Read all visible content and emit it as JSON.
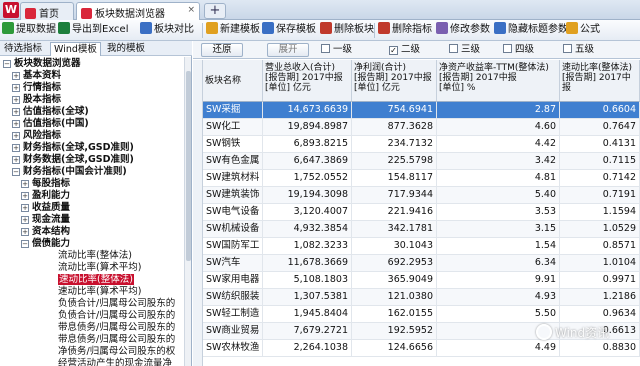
{
  "titlebar": {
    "home_tab": "首页",
    "active_tab": "板块数据浏览器",
    "close_glyph": "×",
    "add_glyph": "+",
    "logo_letter": "W"
  },
  "toolbar": {
    "buttons": [
      {
        "label": "提取数据",
        "icon": "extract-icon",
        "color": "#2e9a3a"
      },
      {
        "label": "导出到Excel",
        "icon": "excel-icon",
        "color": "#1e7f3c"
      },
      {
        "label": "板块对比",
        "icon": "compare-icon",
        "color": "#3a6fc4"
      },
      {
        "label": "新建模板",
        "icon": "new-template-icon",
        "color": "#e0a020"
      },
      {
        "label": "保存模板",
        "icon": "save-template-icon",
        "color": "#3a6fc4"
      },
      {
        "label": "删除板块",
        "icon": "delete-sector-icon",
        "color": "#c0392b"
      },
      {
        "label": "删除指标",
        "icon": "delete-indicator-icon",
        "color": "#c0392b"
      },
      {
        "label": "修改参数",
        "icon": "edit-params-icon",
        "color": "#7a5fb0"
      },
      {
        "label": "隐藏标题参数",
        "icon": "hide-title-icon",
        "color": "#3a6fc4"
      },
      {
        "label": "公式",
        "icon": "formula-icon",
        "color": "#e0a020"
      }
    ]
  },
  "left": {
    "tabs": [
      "待选指标",
      "Wind模板",
      "我的模板"
    ],
    "tree": [
      {
        "label": "板块数据浏览器",
        "level": 0,
        "expander": "−",
        "bold": true
      },
      {
        "label": "基本资料",
        "level": 1,
        "expander": "+",
        "bold": true
      },
      {
        "label": "行情指标",
        "level": 1,
        "expander": "+",
        "bold": true
      },
      {
        "label": "股本指标",
        "level": 1,
        "expander": "+",
        "bold": true
      },
      {
        "label": "估值指标(全球)",
        "level": 1,
        "expander": "+",
        "bold": true
      },
      {
        "label": "估值指标(中国)",
        "level": 1,
        "expander": "+",
        "bold": true
      },
      {
        "label": "风险指标",
        "level": 1,
        "expander": "+",
        "bold": true
      },
      {
        "label": "财务指标(全球,GSD准则)",
        "level": 1,
        "expander": "+",
        "bold": true
      },
      {
        "label": "财务数据(全球,GSD准则)",
        "level": 1,
        "expander": "+",
        "bold": true
      },
      {
        "label": "财务指标(中国会计准则)",
        "level": 1,
        "expander": "−",
        "bold": true
      },
      {
        "label": "每股指标",
        "level": 2,
        "expander": "+",
        "bold": true
      },
      {
        "label": "盈利能力",
        "level": 2,
        "expander": "+",
        "bold": true
      },
      {
        "label": "收益质量",
        "level": 2,
        "expander": "+",
        "bold": true
      },
      {
        "label": "现金流量",
        "level": 2,
        "expander": "+",
        "bold": true
      },
      {
        "label": "资本结构",
        "level": 2,
        "expander": "+",
        "bold": true
      },
      {
        "label": "偿债能力",
        "level": 2,
        "expander": "−",
        "bold": true
      },
      {
        "label": "流动比率(整体法)",
        "level": 3,
        "expander": "",
        "bold": false
      },
      {
        "label": "流动比率(算术平均)",
        "level": 3,
        "expander": "",
        "bold": false
      },
      {
        "label": "速动比率(整体法)",
        "level": 3,
        "expander": "",
        "bold": false,
        "selected": true
      },
      {
        "label": "速动比率(算术平均)",
        "level": 3,
        "expander": "",
        "bold": false
      },
      {
        "label": "负债合计/归属母公司股东的",
        "level": 3,
        "expander": "",
        "bold": false
      },
      {
        "label": "负债合计/归属母公司股东的",
        "level": 3,
        "expander": "",
        "bold": false
      },
      {
        "label": "带息债务/归属母公司股东的",
        "level": 3,
        "expander": "",
        "bold": false
      },
      {
        "label": "带息债务/归属母公司股东的",
        "level": 3,
        "expander": "",
        "bold": false
      },
      {
        "label": "净债务/归属母公司股东的权",
        "level": 3,
        "expander": "",
        "bold": false
      },
      {
        "label": "经营活动产生的现金流量净",
        "level": 3,
        "expander": "",
        "bold": false
      }
    ]
  },
  "filter": {
    "restore": "还原",
    "expand": "展开",
    "levels": [
      {
        "label": "一级",
        "checked": false
      },
      {
        "label": "二级",
        "checked": true
      },
      {
        "label": "三级",
        "checked": false
      },
      {
        "label": "四级",
        "checked": false
      },
      {
        "label": "五级",
        "checked": false
      }
    ],
    "check_glyph": "✓"
  },
  "table": {
    "headers": [
      "板块名称",
      "营业总收入(合计)\n[报告期] 2017中报\n[单位] 亿元",
      "净利润(合计)\n[报告期] 2017中报\n[单位] 亿元",
      "净资产收益率-TTM(整体法)\n[报告期] 2017中报\n[单位] %",
      "速动比率(整体法)\n[报告期] 2017中报"
    ],
    "rows": [
      [
        "SW采掘",
        "14,673.6639",
        "754.6941",
        "2.87",
        "0.6604"
      ],
      [
        "SW化工",
        "19,894.8987",
        "877.3628",
        "4.60",
        "0.7647"
      ],
      [
        "SW钢铁",
        "6,893.8215",
        "234.7132",
        "4.42",
        "0.4131"
      ],
      [
        "SW有色金属",
        "6,647.3869",
        "225.5798",
        "3.42",
        "0.7115"
      ],
      [
        "SW建筑材料",
        "1,752.0552",
        "154.8117",
        "4.81",
        "0.7142"
      ],
      [
        "SW建筑装饰",
        "19,194.3098",
        "717.9344",
        "5.40",
        "0.7191"
      ],
      [
        "SW电气设备",
        "3,120.4007",
        "221.9416",
        "3.53",
        "1.1594"
      ],
      [
        "SW机械设备",
        "4,932.3854",
        "342.1781",
        "3.15",
        "1.0529"
      ],
      [
        "SW国防军工",
        "1,082.3233",
        "30.1043",
        "1.54",
        "0.8571"
      ],
      [
        "SW汽车",
        "11,678.3669",
        "692.2953",
        "6.34",
        "1.0104"
      ],
      [
        "SW家用电器",
        "5,108.1803",
        "365.9049",
        "9.91",
        "0.9971"
      ],
      [
        "SW纺织服装",
        "1,307.5381",
        "121.0380",
        "4.93",
        "1.2186"
      ],
      [
        "SW轻工制造",
        "1,945.8404",
        "162.0155",
        "5.50",
        "0.9634"
      ],
      [
        "SW商业贸易",
        "7,679.2721",
        "192.5952",
        "",
        "0.6613"
      ],
      [
        "SW农林牧渔",
        "2,264.1038",
        "124.6656",
        "4.49",
        "0.8830"
      ]
    ],
    "selected_row": 0
  },
  "watermark": "Wind资讯"
}
